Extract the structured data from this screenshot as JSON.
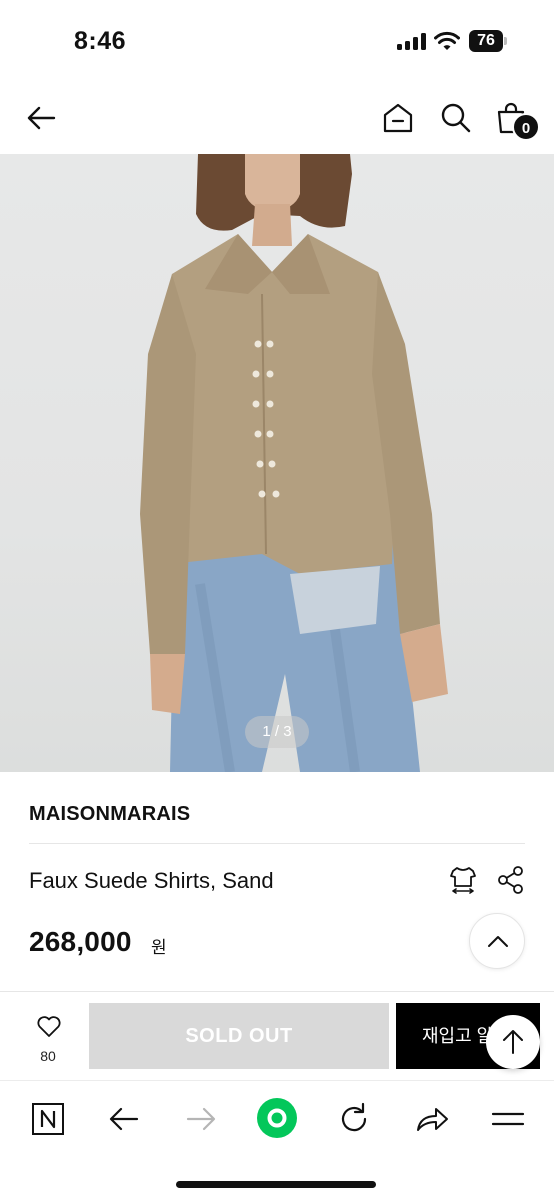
{
  "status": {
    "time": "8:46",
    "battery": "76",
    "icons": [
      "cellular-signal-icon",
      "wifi-icon",
      "battery-icon"
    ]
  },
  "header": {
    "icons": [
      "back-arrow-icon",
      "home-icon",
      "search-icon",
      "shopping-bag-icon"
    ],
    "cart_count": "0"
  },
  "gallery": {
    "counter": "1 / 3"
  },
  "product": {
    "brand": "MAISONMARAIS",
    "name": "Faux Suede Shirts, Sand",
    "price": "268,000",
    "currency": "원"
  },
  "actions": {
    "wish_count": "80",
    "sold_out_label": "SOLD OUT",
    "restock_label": "재입고 알림"
  },
  "browser_toolbar": {
    "icons": [
      "naver-n-icon",
      "back-icon",
      "forward-icon",
      "green-dot-icon",
      "reload-icon",
      "share-icon",
      "menu-icon"
    ]
  },
  "colors": {
    "accent_green": "#03c75a",
    "sold_out_gray": "#d9d9d9",
    "button_black": "#000000"
  }
}
